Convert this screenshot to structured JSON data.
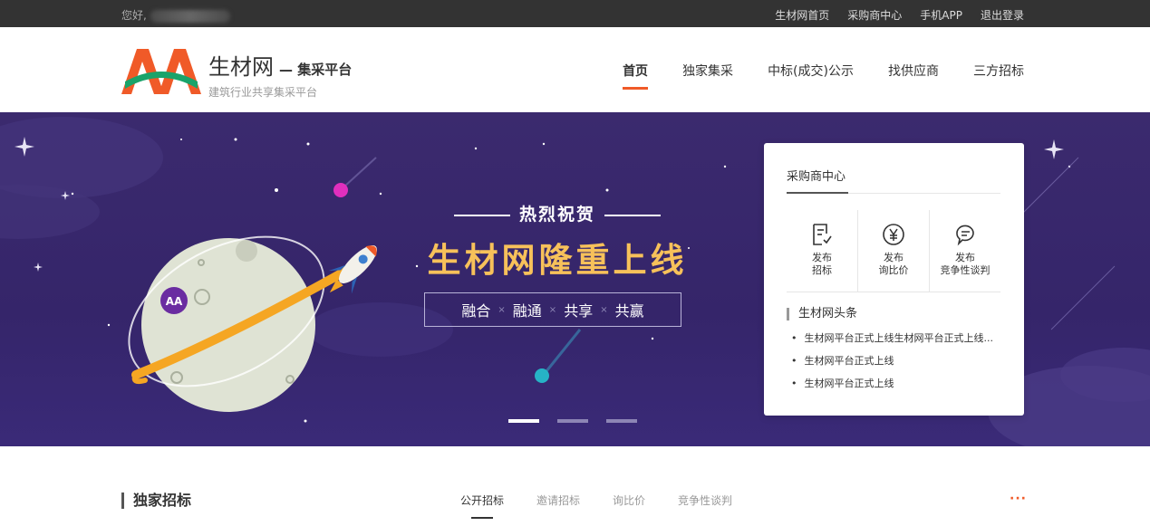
{
  "topbar": {
    "greeting": "您好,",
    "links": [
      "生材网首页",
      "采购商中心",
      "手机APP",
      "退出登录"
    ]
  },
  "header": {
    "brand_name": "生材网",
    "brand_sub": "— 集采平台",
    "slogan": "建筑行业共享集采平台",
    "logo_text": "AA",
    "nav": [
      "首页",
      "独家集采",
      "中标(成交)公示",
      "找供应商",
      "三方招标"
    ]
  },
  "banner": {
    "congrats": "热烈祝贺",
    "headline": "生材网隆重上线",
    "motto": [
      "融合",
      "融通",
      "共享",
      "共赢"
    ],
    "moon_badge": "AA",
    "slides": 3,
    "active_slide": 1
  },
  "card": {
    "title": "采购商中心",
    "actions": [
      {
        "line1": "发布",
        "line2": "招标",
        "icon": "document-icon"
      },
      {
        "line1": "发布",
        "line2": "询比价",
        "icon": "yen-icon"
      },
      {
        "line1": "发布",
        "line2": "竞争性谈判",
        "icon": "chat-icon"
      }
    ],
    "news_title": "生材网头条",
    "news": [
      "生材网平台正式上线生材网平台正式上线...",
      "生材网平台正式上线",
      "生材网平台正式上线"
    ]
  },
  "section": {
    "title": "独家招标",
    "tabs": [
      "公开招标",
      "邀请招标",
      "询比价",
      "竞争性谈判"
    ],
    "more": "···"
  },
  "colors": {
    "accent": "#f05a28",
    "banner_bg": "#3b2a6e",
    "headline": "#f7c15a",
    "logo_green": "#1aa36a"
  }
}
